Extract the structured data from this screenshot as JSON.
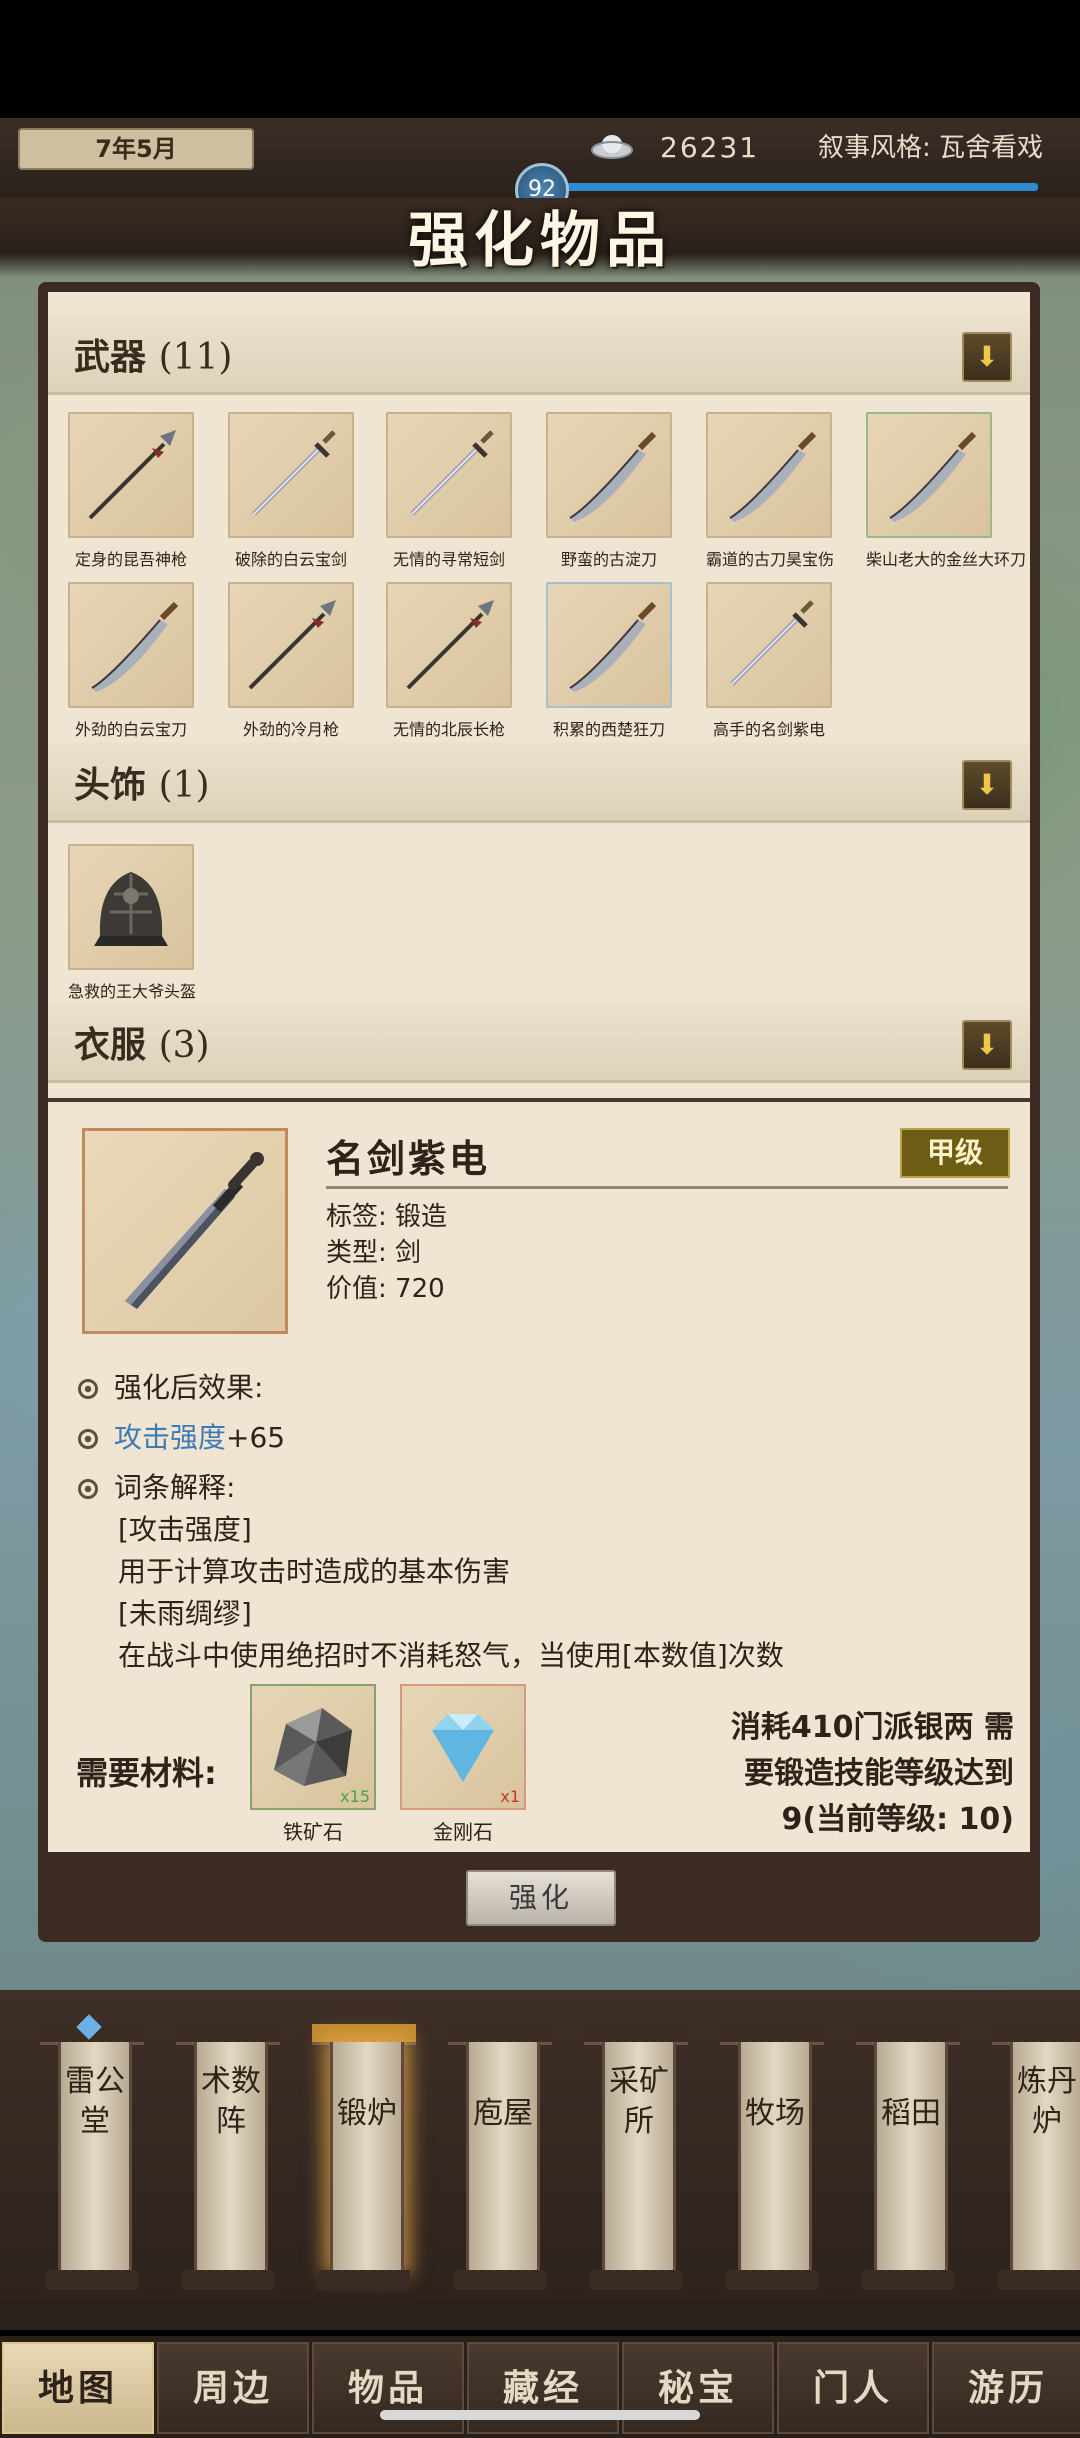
{
  "top": {
    "date": "7年5月",
    "silver": "26231",
    "narrative": "叙事风格: 瓦舍看戏",
    "level": "92"
  },
  "title": "强化物品",
  "sections": {
    "weapon": {
      "title": "武器",
      "count": "(11)"
    },
    "head": {
      "title": "头饰",
      "count": "(1)"
    },
    "cloth": {
      "title": "衣服",
      "count": "(3)"
    }
  },
  "weapons": [
    {
      "name": "定身的昆吾神枪",
      "icon": "spear"
    },
    {
      "name": "破除的白云宝剑",
      "icon": "sword"
    },
    {
      "name": "无情的寻常短剑",
      "icon": "sword"
    },
    {
      "name": "野蛮的古淀刀",
      "icon": "saber"
    },
    {
      "name": "霸道的古刀昊宝伤",
      "icon": "saber"
    },
    {
      "name": "柴山老大的金丝大环刀",
      "icon": "saber"
    },
    {
      "name": "外劲的白云宝刀",
      "icon": "saber"
    },
    {
      "name": "外劲的冷月枪",
      "icon": "spear"
    },
    {
      "name": "无情的北辰长枪",
      "icon": "spear"
    },
    {
      "name": "积累的西楚狂刀",
      "icon": "saber"
    },
    {
      "name": "高手的名剑紫电",
      "icon": "sword"
    }
  ],
  "heads": [
    {
      "name": "急救的王大爷头盔",
      "icon": "helmet"
    }
  ],
  "detail": {
    "name": "名剑紫电",
    "grade": "甲级",
    "tag_label": "标签:",
    "tag": "锻造",
    "type_label": "类型:",
    "type": "剑",
    "value_label": "价值:",
    "value": "720",
    "effect_title": "强化后效果:",
    "attr": "攻击强度",
    "attr_bonus": "+65",
    "terms_title": "词条解释:",
    "term1": "[攻击强度]",
    "term1_desc": "用于计算攻击时造成的基本伤害",
    "term2": "[未雨绸缪]",
    "term2_desc": "在战斗中使用绝招时不消耗怒气，当使用[本数值]次数"
  },
  "materials": {
    "label": "需要材料:",
    "items": [
      {
        "name": "铁矿石",
        "qty": "x15",
        "qty_color": "#3fa83f"
      },
      {
        "name": "金刚石",
        "qty": "x1",
        "qty_color": "#c0392b"
      }
    ],
    "cost_line1": "消耗410门派银两 需",
    "cost_line2": "要锻造技能等级达到",
    "cost_line3": "9(当前等级: 10)"
  },
  "enhance_button": "强化",
  "buildings": [
    {
      "label": "雷公堂"
    },
    {
      "label": "术数阵"
    },
    {
      "label": "锻炉"
    },
    {
      "label": "庖屋"
    },
    {
      "label": "采矿所"
    },
    {
      "label": "牧场"
    },
    {
      "label": "稻田"
    },
    {
      "label": "炼丹炉"
    }
  ],
  "tabs": [
    "地图",
    "周边",
    "物品",
    "藏经",
    "秘宝",
    "门人",
    "游历"
  ]
}
